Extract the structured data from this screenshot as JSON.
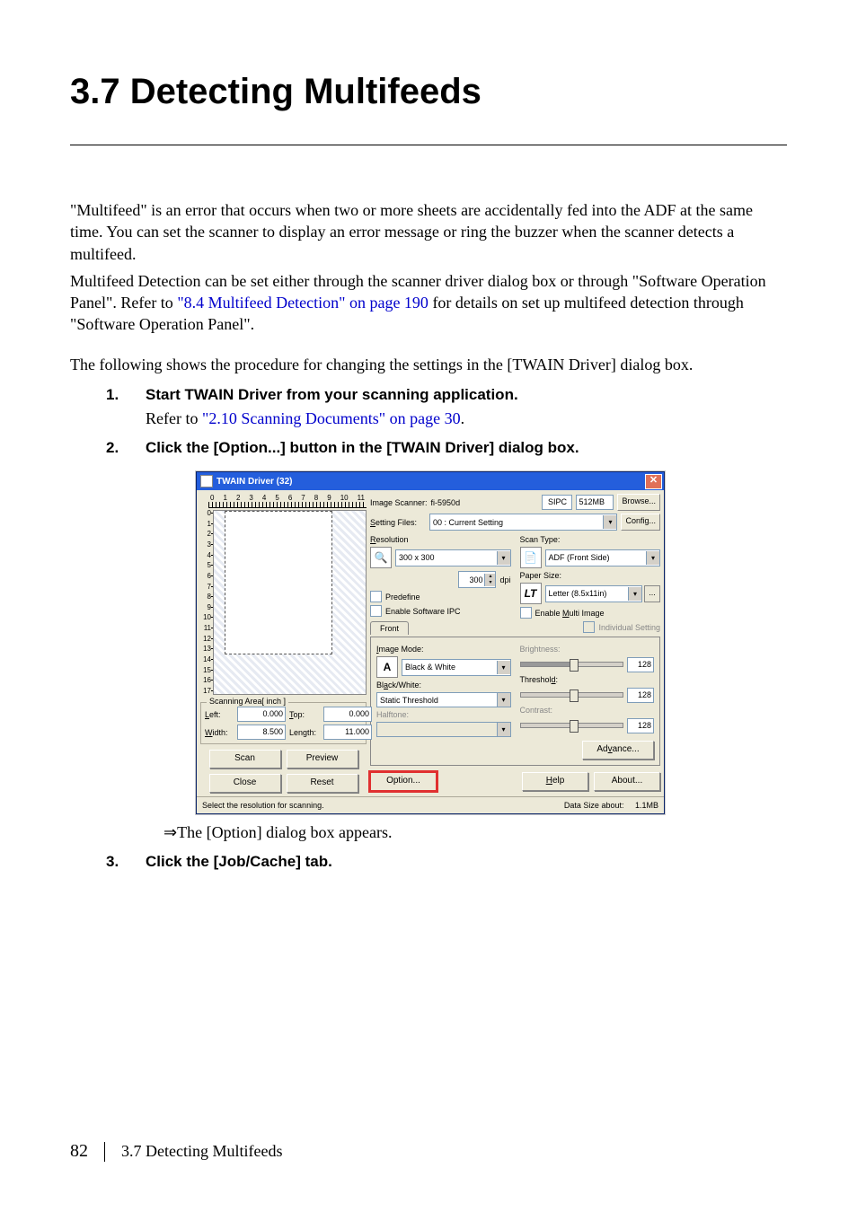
{
  "heading": "3.7  Detecting Multifeeds",
  "intro1": "\"Multifeed\" is an error that occurs when two or more sheets are accidentally fed into the ADF at the same time. You can set the scanner to display an error message or ring the buzzer when the scanner detects a multifeed.",
  "intro2_before": "Multifeed Detection can be set either through the scanner driver dialog box or through \"Software Operation Panel\". Refer to ",
  "intro2_link": "\"8.4 Multifeed Detection\" on page 190",
  "intro2_after": " for details on set up multifeed detection through \"Software Operation Panel\".",
  "intro3": "The following shows the procedure for changing the settings in the [TWAIN Driver] dialog box.",
  "step1_num": "1.",
  "step1_title": "Start TWAIN Driver from your scanning application.",
  "step1_ref_before": "Refer to ",
  "step1_ref_link": "\"2.10 Scanning Documents\" on page 30",
  "step1_ref_after": ".",
  "step2_num": "2.",
  "step2_title": "Click the [Option...] button in the [TWAIN Driver] dialog box.",
  "result_arrow": "⇒",
  "result_text": "The [Option] dialog box appears.",
  "step3_num": "3.",
  "step3_title": "Click the [Job/Cache] tab.",
  "footer_page": "82",
  "footer_text": "3.7 Detecting Multifeeds",
  "win": {
    "title": "TWAIN Driver (32)",
    "image_scanner_lbl": "Image Scanner:",
    "image_scanner_val": "fi-5950d",
    "sipc": "SIPC",
    "mem": "512MB",
    "browse_btn": "Browse...",
    "setting_files_lbl": "Setting Files:",
    "setting_files_val": "00 : Current Setting",
    "config_btn": "Config...",
    "resolution_lbl": "Resolution",
    "resolution_val": "300 x 300",
    "dpi_val": "300",
    "dpi_unit": "dpi",
    "predefine": "Predefine",
    "enable_sipc": "Enable Software IPC",
    "scan_type_lbl": "Scan Type:",
    "scan_type_val": "ADF (Front Side)",
    "paper_size_lbl": "Paper Size:",
    "paper_size_val": "Letter (8.5x11in)",
    "enable_multi": "Enable Multi Image",
    "tab_front": "Front",
    "individual": "Individual Setting",
    "image_mode_lbl": "Image Mode:",
    "image_mode_val": "Black & White",
    "black_white_lbl": "Black/White:",
    "black_white_val": "Static Threshold",
    "halftone_lbl": "Halftone:",
    "brightness_lbl": "Brightness:",
    "threshold_lbl": "Threshold:",
    "contrast_lbl": "Contrast:",
    "s128": "128",
    "advance_btn": "Advance...",
    "option_btn": "Option...",
    "help_btn": "Help",
    "about_btn": "About...",
    "scan_area_label": "Scanning Area[ inch ]",
    "left_lbl": "Left:",
    "left_val": "0.000",
    "top_lbl": "Top:",
    "top_val": "0.000",
    "width_lbl": "Width:",
    "width_val": "8.500",
    "length_lbl": "Length:",
    "length_val": "11.000",
    "scan_btn": "Scan",
    "preview_btn": "Preview",
    "close_btn": "Close",
    "reset_btn": "Reset",
    "status_left": "Select the resolution for scanning.",
    "status_right_lbl": "Data Size about:",
    "status_right_val": "1.1MB",
    "ruler_h": [
      "0",
      "1",
      "2",
      "3",
      "4",
      "5",
      "6",
      "7",
      "8",
      "9",
      "10",
      "11"
    ],
    "ruler_v": [
      "0",
      "1",
      "2",
      "3",
      "4",
      "5",
      "6",
      "7",
      "8",
      "9",
      "10",
      "11",
      "12",
      "13",
      "14",
      "15",
      "16",
      "17"
    ]
  }
}
